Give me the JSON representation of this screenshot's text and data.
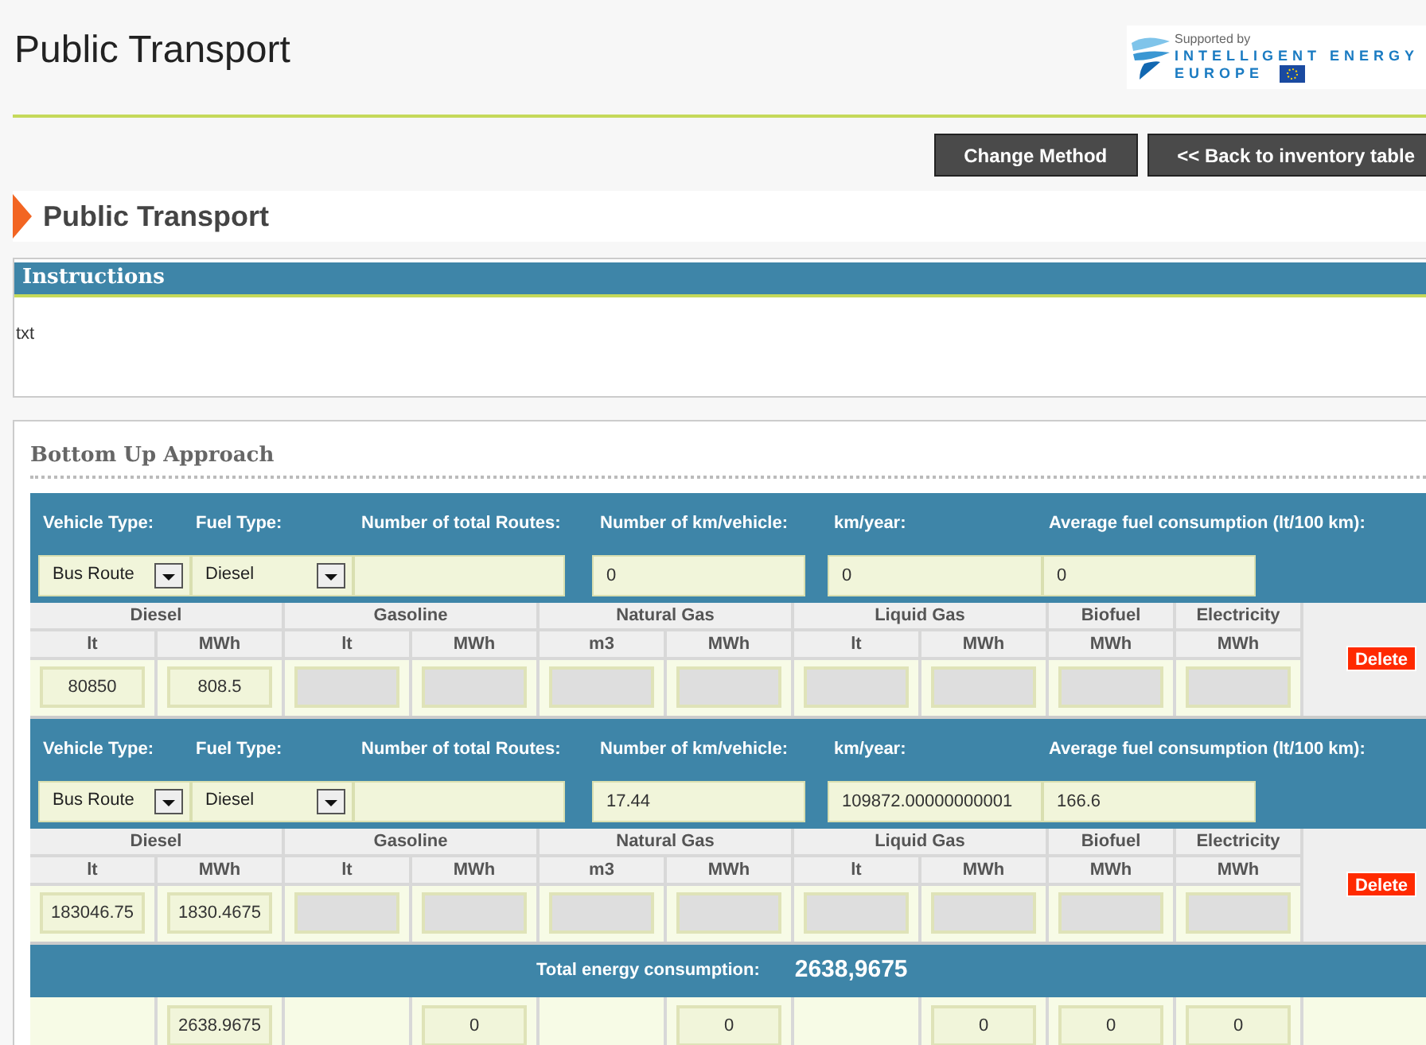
{
  "page_title": "Public Transport",
  "logo": {
    "caption": "Supported by",
    "line_1": "INTELLIGENT ENERGY",
    "line_2": "EUROPE"
  },
  "buttons": [
    "Change Method",
    "<< Back to inventory table"
  ],
  "section_title": "Public Transport",
  "instructions": {
    "title": "Instructions",
    "text": "txt"
  },
  "approach": {
    "title": "Bottom Up Approach",
    "entries": [
      {
        "field_labels": [
          "Vehicle Type:",
          "Fuel Type:",
          "Number of total Routes:",
          "Number of km/vehicle:",
          "km/year:",
          "Average fuel consumption (lt/100 km):"
        ],
        "vehicle_type": "Bus Route",
        "fuel_type": "Diesel",
        "km_per_vehicle": {
          "value": "0"
        },
        "km_per_year": {
          "value": "0"
        },
        "avg_consumption": {
          "value": "0"
        },
        "fuel_groups": [
          {
            "name": "Diesel",
            "units": [
              "lt",
              "MWh"
            ]
          },
          {
            "name": "Gasoline",
            "units": [
              "lt",
              "MWh"
            ]
          },
          {
            "name": "Natural Gas",
            "units": [
              "m3",
              "MWh"
            ]
          },
          {
            "name": "Liquid Gas",
            "units": [
              "lt",
              "MWh"
            ]
          },
          {
            "name": "Biofuel",
            "units": [
              "MWh"
            ]
          },
          {
            "name": "Electricity",
            "units": [
              "MWh"
            ]
          }
        ],
        "values": [
          {
            "value": "80850",
            "disabled": false
          },
          {
            "value": "808.5",
            "disabled": false
          },
          {
            "disabled": true
          },
          {
            "disabled": true
          },
          {
            "disabled": true
          },
          {
            "disabled": true
          },
          {
            "disabled": true
          },
          {
            "disabled": true
          },
          {
            "disabled": true
          },
          {
            "disabled": true
          }
        ],
        "delete": "Delete"
      },
      {
        "field_labels": [
          "Vehicle Type:",
          "Fuel Type:",
          "Number of total Routes:",
          "Number of km/vehicle:",
          "km/year:",
          "Average fuel consumption (lt/100 km):"
        ],
        "vehicle_type": "Bus Route",
        "fuel_type": "Diesel",
        "km_per_vehicle": {
          "value": "17.44"
        },
        "km_per_year": {
          "value": "109872.00000000001"
        },
        "avg_consumption": {
          "value": "166.6"
        },
        "fuel_groups": [
          {
            "name": "Diesel",
            "units": [
              "lt",
              "MWh"
            ]
          },
          {
            "name": "Gasoline",
            "units": [
              "lt",
              "MWh"
            ]
          },
          {
            "name": "Natural Gas",
            "units": [
              "m3",
              "MWh"
            ]
          },
          {
            "name": "Liquid Gas",
            "units": [
              "lt",
              "MWh"
            ]
          },
          {
            "name": "Biofuel",
            "units": [
              "MWh"
            ]
          },
          {
            "name": "Electricity",
            "units": [
              "MWh"
            ]
          }
        ],
        "values": [
          {
            "value": "183046.75",
            "disabled": false
          },
          {
            "value": "1830.4675",
            "disabled": false
          },
          {
            "disabled": true
          },
          {
            "disabled": true
          },
          {
            "disabled": true
          },
          {
            "disabled": true
          },
          {
            "disabled": true
          },
          {
            "disabled": true
          },
          {
            "disabled": true
          },
          {
            "disabled": true
          }
        ],
        "delete": "Delete"
      }
    ],
    "total": {
      "label": "Total energy consumption:",
      "value": "2638,9675",
      "cells": [
        {
          "kind": "blank"
        },
        {
          "kind": "field",
          "value": "2638.9675"
        },
        {
          "kind": "blank"
        },
        {
          "kind": "field",
          "value": "0"
        },
        {
          "kind": "blank"
        },
        {
          "kind": "field",
          "value": "0"
        },
        {
          "kind": "blank"
        },
        {
          "kind": "field",
          "value": "0"
        },
        {
          "kind": "field",
          "value": "0"
        },
        {
          "kind": "field",
          "value": "0"
        }
      ]
    }
  }
}
